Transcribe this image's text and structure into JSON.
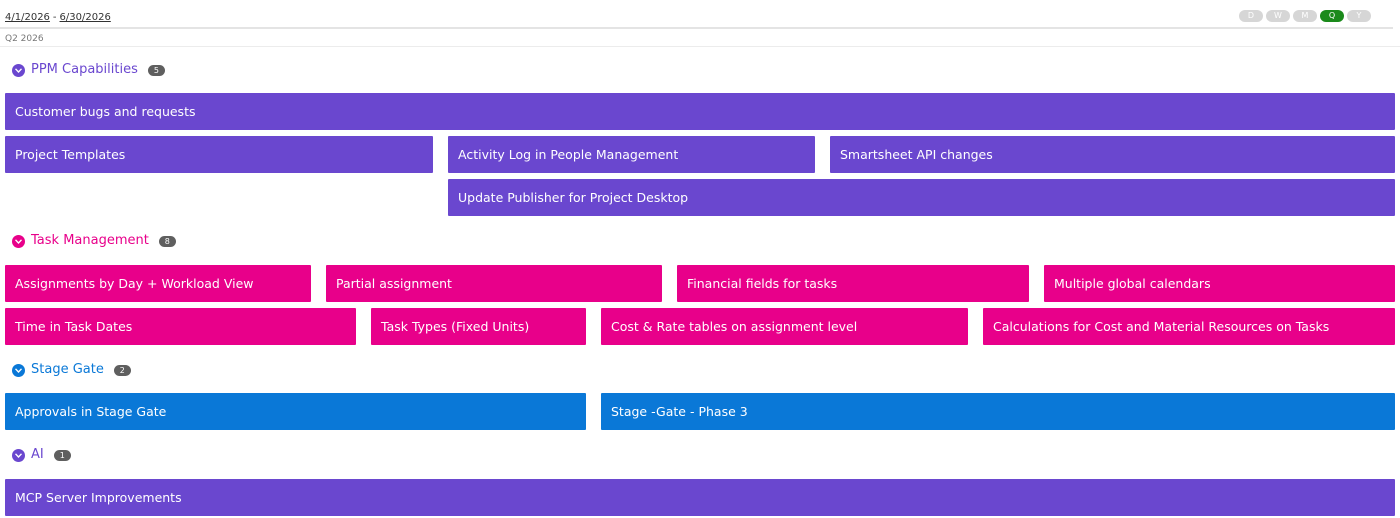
{
  "header": {
    "date_start": "4/1/2026",
    "date_separator": "-",
    "date_end": "6/30/2026",
    "quarter_label": "Q2 2026",
    "scale_options": [
      "D",
      "W",
      "M",
      "Q",
      "Y"
    ],
    "scale_selected": "Q"
  },
  "colors": {
    "ppm": "#6a47cf",
    "task": "#e8008a",
    "stage": "#0a78d7",
    "ai": "#6a47cf",
    "scale_active": "#1b8a1b"
  },
  "groups": {
    "ppm": {
      "title": "PPM Capabilities",
      "count": "5",
      "items": [
        "Customer bugs and requests",
        "Project Templates",
        "Activity Log in People Management",
        "Smartsheet API changes",
        "Update Publisher for Project Desktop"
      ]
    },
    "task": {
      "title": "Task Management",
      "count": "8",
      "items": [
        "Assignments by Day + Workload View",
        "Partial assignment",
        "Financial fields for tasks",
        "Multiple global calendars",
        "Time in Task Dates",
        "Task Types (Fixed Units)",
        "Cost & Rate tables on assignment level",
        "Calculations for Cost and Material Resources on Tasks"
      ]
    },
    "stage": {
      "title": "Stage Gate",
      "count": "2",
      "items": [
        "Approvals in Stage Gate",
        "Stage -Gate - Phase 3"
      ]
    },
    "ai": {
      "title": "AI",
      "count": "1",
      "items": [
        "MCP Server Improvements"
      ]
    }
  }
}
